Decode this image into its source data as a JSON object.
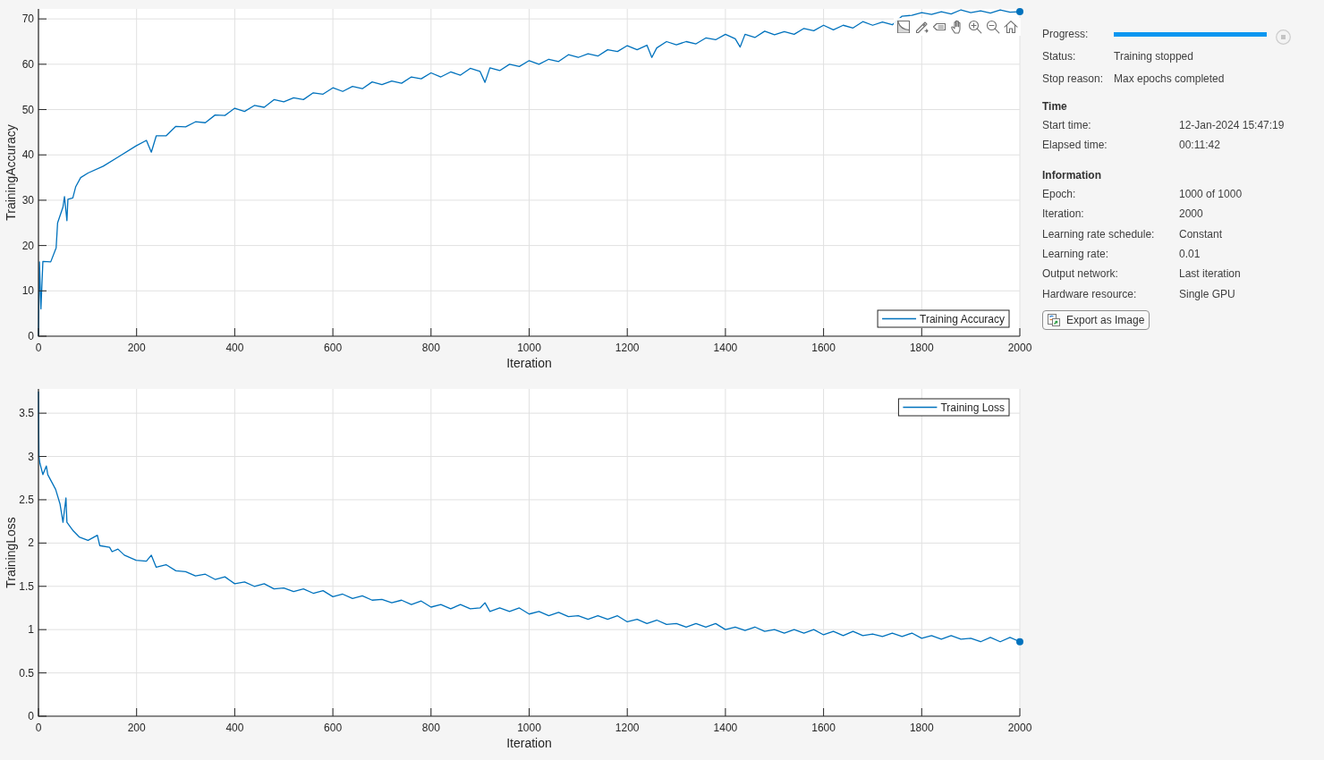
{
  "plots": [
    {
      "toolbar_shown": true,
      "legend_top": false,
      "chart_data": {
        "type": "line",
        "xlabel": "Iteration",
        "ylabel": "TrainingAccuracy",
        "grid": true,
        "x": [
          0,
          2,
          5,
          9,
          25,
          36,
          39,
          50,
          53,
          58,
          60,
          70,
          76,
          86,
          101,
          132,
          162,
          199,
          220,
          230,
          240,
          260,
          280,
          300,
          320,
          340,
          360,
          380,
          400,
          420,
          440,
          460,
          480,
          500,
          520,
          540,
          560,
          580,
          600,
          620,
          640,
          660,
          680,
          700,
          720,
          740,
          760,
          780,
          800,
          820,
          840,
          860,
          880,
          900,
          910,
          920,
          940,
          960,
          980,
          1000,
          1020,
          1040,
          1060,
          1080,
          1100,
          1120,
          1140,
          1160,
          1180,
          1200,
          1220,
          1240,
          1250,
          1260,
          1280,
          1300,
          1320,
          1340,
          1360,
          1380,
          1400,
          1420,
          1430,
          1440,
          1460,
          1480,
          1500,
          1520,
          1540,
          1560,
          1580,
          1600,
          1620,
          1640,
          1660,
          1680,
          1700,
          1720,
          1740,
          1760,
          1780,
          1800,
          1820,
          1840,
          1860,
          1880,
          1900,
          1920,
          1940,
          1960,
          1980,
          2000
        ],
        "series": [
          {
            "name": "Training Accuracy",
            "color": "#0072bd",
            "values": [
              0,
              16.4,
              6,
              16.5,
              16.4,
              19.5,
              25,
              28.5,
              30.8,
              25.5,
              30.2,
              30.5,
              33,
              35,
              36,
              37.5,
              39.5,
              42,
              43.2,
              40.6,
              44.2,
              44.2,
              46.3,
              46.2,
              47.3,
              47.1,
              48.8,
              48.7,
              50.3,
              49.6,
              50.9,
              50.5,
              52.2,
              51.7,
              52.6,
              52.2,
              53.7,
              53.4,
              54.8,
              54.0,
              55.1,
              54.6,
              56.1,
              55.5,
              56.3,
              55.8,
              57.2,
              56.8,
              58.1,
              57.2,
              58.3,
              57.6,
              59.1,
              58.4,
              56.0,
              59.2,
              58.6,
              60.0,
              59.5,
              60.8,
              60.0,
              61.1,
              60.6,
              62.1,
              61.5,
              62.3,
              61.8,
              63.2,
              62.8,
              64.1,
              63.2,
              64.2,
              61.5,
              63.6,
              65.0,
              64.3,
              65.0,
              64.5,
              65.8,
              65.4,
              66.6,
              65.6,
              63.8,
              66.6,
              65.9,
              67.3,
              66.5,
              67.2,
              66.6,
              67.9,
              67.4,
              68.6,
              67.6,
              68.6,
              68.0,
              69.4,
              68.6,
              69.3,
              68.7,
              70.6,
              70.8,
              71.4,
              71.0,
              71.6,
              71.1,
              72.0,
              71.4,
              71.8,
              71.3,
              72.0,
              71.5,
              71.6
            ]
          }
        ],
        "xlim": [
          0,
          2000
        ],
        "ylim": [
          0,
          72.2
        ],
        "xticks": [
          {
            "value": 0,
            "label": "0"
          },
          {
            "value": 200,
            "label": "200"
          },
          {
            "value": 400,
            "label": "400"
          },
          {
            "value": 600,
            "label": "600"
          },
          {
            "value": 800,
            "label": "800"
          },
          {
            "value": 1000,
            "label": "1000"
          },
          {
            "value": 1200,
            "label": "1200"
          },
          {
            "value": 1400,
            "label": "1400"
          },
          {
            "value": 1600,
            "label": "1600"
          },
          {
            "value": 1800,
            "label": "1800"
          },
          {
            "value": 2000,
            "label": "2000"
          }
        ],
        "yticks": [
          {
            "value": 0,
            "label": "0"
          },
          {
            "value": 10,
            "label": "10"
          },
          {
            "value": 20,
            "label": "20"
          },
          {
            "value": 30,
            "label": "30"
          },
          {
            "value": 40,
            "label": "40"
          },
          {
            "value": 50,
            "label": "50"
          },
          {
            "value": 60,
            "label": "60"
          },
          {
            "value": 70,
            "label": "70"
          }
        ]
      }
    },
    {
      "toolbar_shown": false,
      "legend_top": true,
      "chart_data": {
        "type": "line",
        "xlabel": "Iteration",
        "ylabel": "TrainingLoss",
        "grid": true,
        "x": [
          0,
          1,
          3,
          9,
          16,
          19,
          35,
          44,
          50,
          56,
          58,
          71,
          83,
          101,
          120,
          125,
          145,
          150,
          162,
          175,
          199,
          220,
          230,
          240,
          260,
          280,
          300,
          320,
          340,
          360,
          380,
          400,
          420,
          440,
          460,
          480,
          500,
          520,
          540,
          560,
          580,
          600,
          620,
          640,
          660,
          680,
          700,
          720,
          740,
          760,
          780,
          800,
          820,
          840,
          860,
          880,
          900,
          910,
          920,
          940,
          960,
          980,
          1000,
          1020,
          1040,
          1060,
          1080,
          1100,
          1120,
          1140,
          1160,
          1180,
          1200,
          1220,
          1240,
          1260,
          1280,
          1300,
          1320,
          1340,
          1360,
          1380,
          1400,
          1420,
          1440,
          1460,
          1480,
          1500,
          1520,
          1540,
          1560,
          1580,
          1600,
          1620,
          1640,
          1660,
          1680,
          1700,
          1720,
          1740,
          1760,
          1780,
          1800,
          1820,
          1840,
          1860,
          1880,
          1900,
          1920,
          1940,
          1960,
          1980,
          2000
        ],
        "series": [
          {
            "name": "Training Loss",
            "color": "#0072bd",
            "values": [
              3.75,
              3.0,
              2.92,
              2.79,
              2.89,
              2.79,
              2.62,
              2.45,
              2.24,
              2.52,
              2.24,
              2.14,
              2.07,
              2.03,
              2.09,
              1.97,
              1.95,
              1.9,
              1.93,
              1.86,
              1.8,
              1.79,
              1.86,
              1.72,
              1.75,
              1.68,
              1.67,
              1.62,
              1.64,
              1.58,
              1.61,
              1.53,
              1.55,
              1.5,
              1.53,
              1.47,
              1.48,
              1.44,
              1.47,
              1.42,
              1.45,
              1.38,
              1.41,
              1.36,
              1.39,
              1.34,
              1.35,
              1.31,
              1.34,
              1.29,
              1.33,
              1.26,
              1.29,
              1.24,
              1.29,
              1.24,
              1.25,
              1.31,
              1.21,
              1.25,
              1.21,
              1.25,
              1.18,
              1.21,
              1.16,
              1.2,
              1.15,
              1.16,
              1.12,
              1.16,
              1.12,
              1.16,
              1.09,
              1.12,
              1.07,
              1.11,
              1.06,
              1.07,
              1.03,
              1.07,
              1.03,
              1.07,
              1.0,
              1.03,
              0.99,
              1.03,
              0.98,
              1.0,
              0.96,
              1.0,
              0.96,
              1.0,
              0.94,
              0.98,
              0.93,
              0.98,
              0.93,
              0.95,
              0.92,
              0.96,
              0.92,
              0.96,
              0.9,
              0.93,
              0.89,
              0.93,
              0.89,
              0.9,
              0.86,
              0.91,
              0.86,
              0.91,
              0.86
            ]
          }
        ],
        "xlim": [
          0,
          2000
        ],
        "ylim": [
          0,
          3.78
        ],
        "xticks": [
          {
            "value": 0,
            "label": "0"
          },
          {
            "value": 200,
            "label": "200"
          },
          {
            "value": 400,
            "label": "400"
          },
          {
            "value": 600,
            "label": "600"
          },
          {
            "value": 800,
            "label": "800"
          },
          {
            "value": 1000,
            "label": "1000"
          },
          {
            "value": 1200,
            "label": "1200"
          },
          {
            "value": 1400,
            "label": "1400"
          },
          {
            "value": 1600,
            "label": "1600"
          },
          {
            "value": 1800,
            "label": "1800"
          },
          {
            "value": 2000,
            "label": "2000"
          }
        ],
        "yticks": [
          {
            "value": 0,
            "label": "0"
          },
          {
            "value": 0.5,
            "label": "0.5"
          },
          {
            "value": 1,
            "label": "1"
          },
          {
            "value": 1.5,
            "label": "1.5"
          },
          {
            "value": 2,
            "label": "2"
          },
          {
            "value": 2.5,
            "label": "2.5"
          },
          {
            "value": 3,
            "label": "3"
          },
          {
            "value": 3.5,
            "label": "3.5"
          }
        ]
      }
    }
  ],
  "progress": {
    "label": "Progress:",
    "level": 1
  },
  "stop_button": {
    "disabled": true
  },
  "status_rows": [
    {
      "label": "Status:",
      "value": "Training stopped"
    },
    {
      "label": "Stop reason:",
      "value": "Max epochs completed"
    }
  ],
  "sections": [
    {
      "title": "Time",
      "rows": [
        {
          "label": "Start time:",
          "value": "12-Jan-2024 15:47:19"
        },
        {
          "label": "Elapsed time:",
          "value": "00:11:42"
        }
      ]
    },
    {
      "title": "Information",
      "rows": [
        {
          "label": "Epoch:",
          "value": "1000 of 1000"
        },
        {
          "label": "Iteration:",
          "value": "2000"
        },
        {
          "label": "Learning rate schedule:",
          "value": "Constant"
        },
        {
          "label": "Learning rate:",
          "value": "0.01"
        },
        {
          "label": "Output network:",
          "value": "Last iteration"
        },
        {
          "label": "Hardware resource:",
          "value": "Single GPU"
        }
      ]
    }
  ],
  "export_button": {
    "label": "Export as Image"
  }
}
